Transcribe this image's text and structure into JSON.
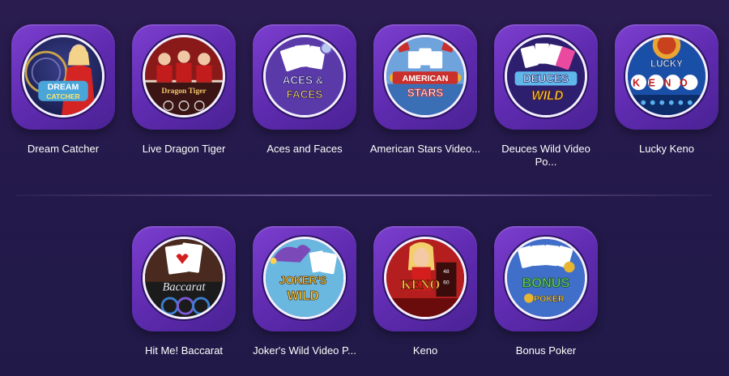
{
  "games_row1": [
    {
      "title": "Dream Catcher",
      "icon": "dream-catcher-icon",
      "logo": [
        "DREAM",
        "CATCHER"
      ]
    },
    {
      "title": "Live Dragon Tiger",
      "icon": "dragon-tiger-icon",
      "logo": [
        "Dragon Tiger"
      ]
    },
    {
      "title": "Aces and Faces",
      "icon": "aces-faces-icon",
      "logo": [
        "ACES &",
        "FACES"
      ]
    },
    {
      "title": "American Stars Video...",
      "icon": "american-stars-icon",
      "logo": [
        "AMERICAN",
        "STARS"
      ]
    },
    {
      "title": "Deuces Wild Video Po...",
      "icon": "deuces-wild-icon",
      "logo": [
        "DEUCES",
        "WILD"
      ]
    },
    {
      "title": "Lucky Keno",
      "icon": "lucky-keno-icon",
      "logo": [
        "LUCKY",
        "KENO"
      ]
    }
  ],
  "games_row2": [
    {
      "title": "Hit Me! Baccarat",
      "icon": "hit-me-baccarat-icon",
      "logo": [
        "Baccarat"
      ]
    },
    {
      "title": "Joker's Wild Video P...",
      "icon": "jokers-wild-icon",
      "logo": [
        "JOKER'S",
        "WILD"
      ]
    },
    {
      "title": "Keno",
      "icon": "keno-icon",
      "logo": [
        "KENO"
      ]
    },
    {
      "title": "Bonus Poker",
      "icon": "bonus-poker-icon",
      "logo": [
        "BONUS",
        "POKER"
      ]
    }
  ],
  "colors": {
    "background": "#24194b",
    "tile_frame": "#6a31bf",
    "title_text": "#ffffff"
  }
}
